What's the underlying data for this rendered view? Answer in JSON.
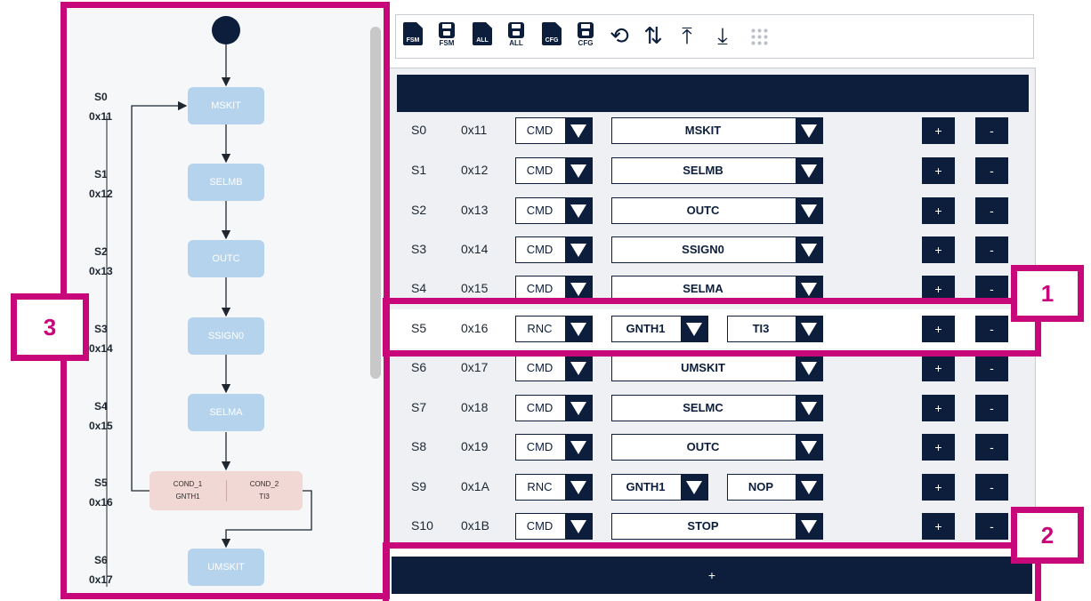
{
  "toolbar": {
    "buttons": [
      {
        "name": "import-fsm-button",
        "icon": "file-fsm-icon",
        "label": "FSM"
      },
      {
        "name": "save-fsm-button",
        "icon": "save-fsm-icon",
        "label": "FSM"
      },
      {
        "name": "import-all-button",
        "icon": "file-all-icon",
        "label": "ALL"
      },
      {
        "name": "save-all-button",
        "icon": "save-all-icon",
        "label": "ALL"
      },
      {
        "name": "import-cfg-button",
        "icon": "file-cfg-icon",
        "label": "CFG"
      },
      {
        "name": "save-cfg-button",
        "icon": "save-cfg-icon",
        "label": "CFG"
      },
      {
        "name": "reset-button",
        "icon": "undo-icon",
        "glyph": "⟲"
      },
      {
        "name": "sync-button",
        "icon": "sync-icon",
        "glyph": "⇅"
      },
      {
        "name": "upload-button",
        "icon": "upload-icon",
        "glyph": "⤒"
      },
      {
        "name": "download-button",
        "icon": "download-icon",
        "glyph": "⤓"
      },
      {
        "name": "drag-handle",
        "icon": "grid-dots-icon"
      }
    ]
  },
  "table": {
    "rows": [
      {
        "state": "S0",
        "hex": "0x11",
        "type": "CMD",
        "value": "MSKIT"
      },
      {
        "state": "S1",
        "hex": "0x12",
        "type": "CMD",
        "value": "SELMB"
      },
      {
        "state": "S2",
        "hex": "0x13",
        "type": "CMD",
        "value": "OUTC"
      },
      {
        "state": "S3",
        "hex": "0x14",
        "type": "CMD",
        "value": "SSIGN0"
      },
      {
        "state": "S4",
        "hex": "0x15",
        "type": "CMD",
        "value": "SELMA"
      },
      {
        "state": "S5",
        "hex": "0x16",
        "type": "RNC",
        "cond": "GNTH1",
        "target": "TI3"
      },
      {
        "state": "S6",
        "hex": "0x17",
        "type": "CMD",
        "value": "UMSKIT"
      },
      {
        "state": "S7",
        "hex": "0x18",
        "type": "CMD",
        "value": "SELMC"
      },
      {
        "state": "S8",
        "hex": "0x19",
        "type": "CMD",
        "value": "OUTC"
      },
      {
        "state": "S9",
        "hex": "0x1A",
        "type": "RNC",
        "cond": "GNTH1",
        "target": "NOP"
      },
      {
        "state": "S10",
        "hex": "0x1B",
        "type": "CMD",
        "value": "STOP"
      }
    ],
    "plus_label": "+",
    "minus_label": "-",
    "add_row_label": "+"
  },
  "flow": {
    "states": [
      {
        "id": "S0",
        "hex": "0x11",
        "label": "MSKIT"
      },
      {
        "id": "S1",
        "hex": "0x12",
        "label": "SELMB"
      },
      {
        "id": "S2",
        "hex": "0x13",
        "label": "OUTC"
      },
      {
        "id": "S3",
        "hex": "0x14",
        "label": "SSIGN0"
      },
      {
        "id": "S4",
        "hex": "0x15",
        "label": "SELMA"
      },
      {
        "id": "S5",
        "hex": "0x16"
      },
      {
        "id": "S6",
        "hex": "0x17",
        "label": "UMSKIT"
      }
    ],
    "condition": {
      "left_title": "COND_1",
      "left_sub": "GNTH1",
      "right_title": "COND_2",
      "right_sub": "TI3"
    }
  },
  "callouts": {
    "c1": "1",
    "c2": "2",
    "c3": "3"
  },
  "colors": {
    "navy": "#0c1e3c",
    "state_box": "#b5d3ec",
    "cond_box": "#f2d8d4",
    "highlight": "#c8077a"
  }
}
